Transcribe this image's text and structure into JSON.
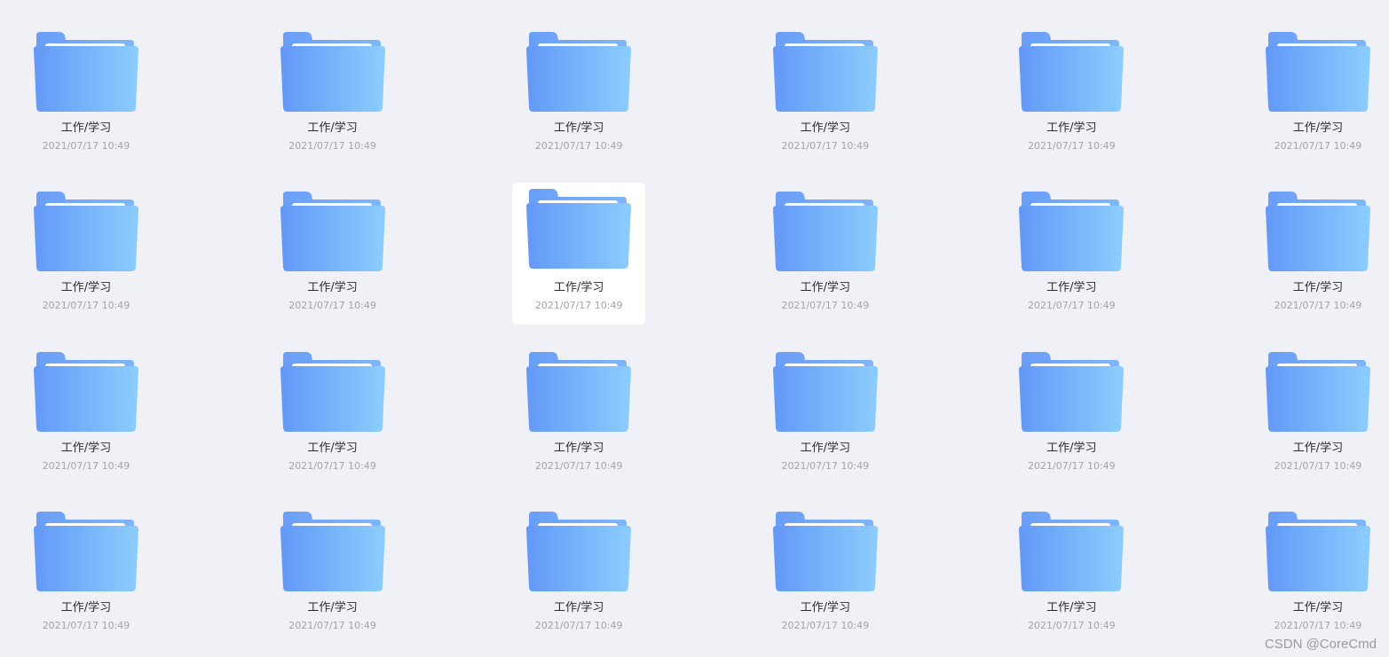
{
  "folders": [
    {
      "name": "工作/学习",
      "date": "2021/07/17 10:49"
    },
    {
      "name": "工作/学习",
      "date": "2021/07/17 10:49"
    },
    {
      "name": "工作/学习",
      "date": "2021/07/17 10:49"
    },
    {
      "name": "工作/学习",
      "date": "2021/07/17 10:49"
    },
    {
      "name": "工作/学习",
      "date": "2021/07/17 10:49"
    },
    {
      "name": "工作/学习",
      "date": "2021/07/17 10:49"
    },
    {
      "name": "工作/学习",
      "date": "2021/07/17 10:49"
    },
    {
      "name": "工作/学习",
      "date": "2021/07/17 10:49"
    },
    {
      "name": "工作/学习",
      "date": "2021/07/17 10:49",
      "selected": true
    },
    {
      "name": "工作/学习",
      "date": "2021/07/17 10:49"
    },
    {
      "name": "工作/学习",
      "date": "2021/07/17 10:49"
    },
    {
      "name": "工作/学习",
      "date": "2021/07/17 10:49"
    },
    {
      "name": "工作/学习",
      "date": "2021/07/17 10:49"
    },
    {
      "name": "工作/学习",
      "date": "2021/07/17 10:49"
    },
    {
      "name": "工作/学习",
      "date": "2021/07/17 10:49"
    },
    {
      "name": "工作/学习",
      "date": "2021/07/17 10:49"
    },
    {
      "name": "工作/学习",
      "date": "2021/07/17 10:49"
    },
    {
      "name": "工作/学习",
      "date": "2021/07/17 10:49"
    },
    {
      "name": "工作/学习",
      "date": "2021/07/17 10:49"
    },
    {
      "name": "工作/学习",
      "date": "2021/07/17 10:49"
    },
    {
      "name": "工作/学习",
      "date": "2021/07/17 10:49"
    },
    {
      "name": "工作/学习",
      "date": "2021/07/17 10:49"
    },
    {
      "name": "工作/学习",
      "date": "2021/07/17 10:49"
    },
    {
      "name": "工作/学习",
      "date": "2021/07/17 10:49"
    }
  ],
  "icon": "folder-icon",
  "colors": {
    "background": "#f0f1f7",
    "folder_left": "#6398f8",
    "folder_right": "#8ccdfd",
    "folder_back": "#78aaf6",
    "selected_bg": "#ffffff"
  },
  "watermark": "CSDN @CoreCmd"
}
